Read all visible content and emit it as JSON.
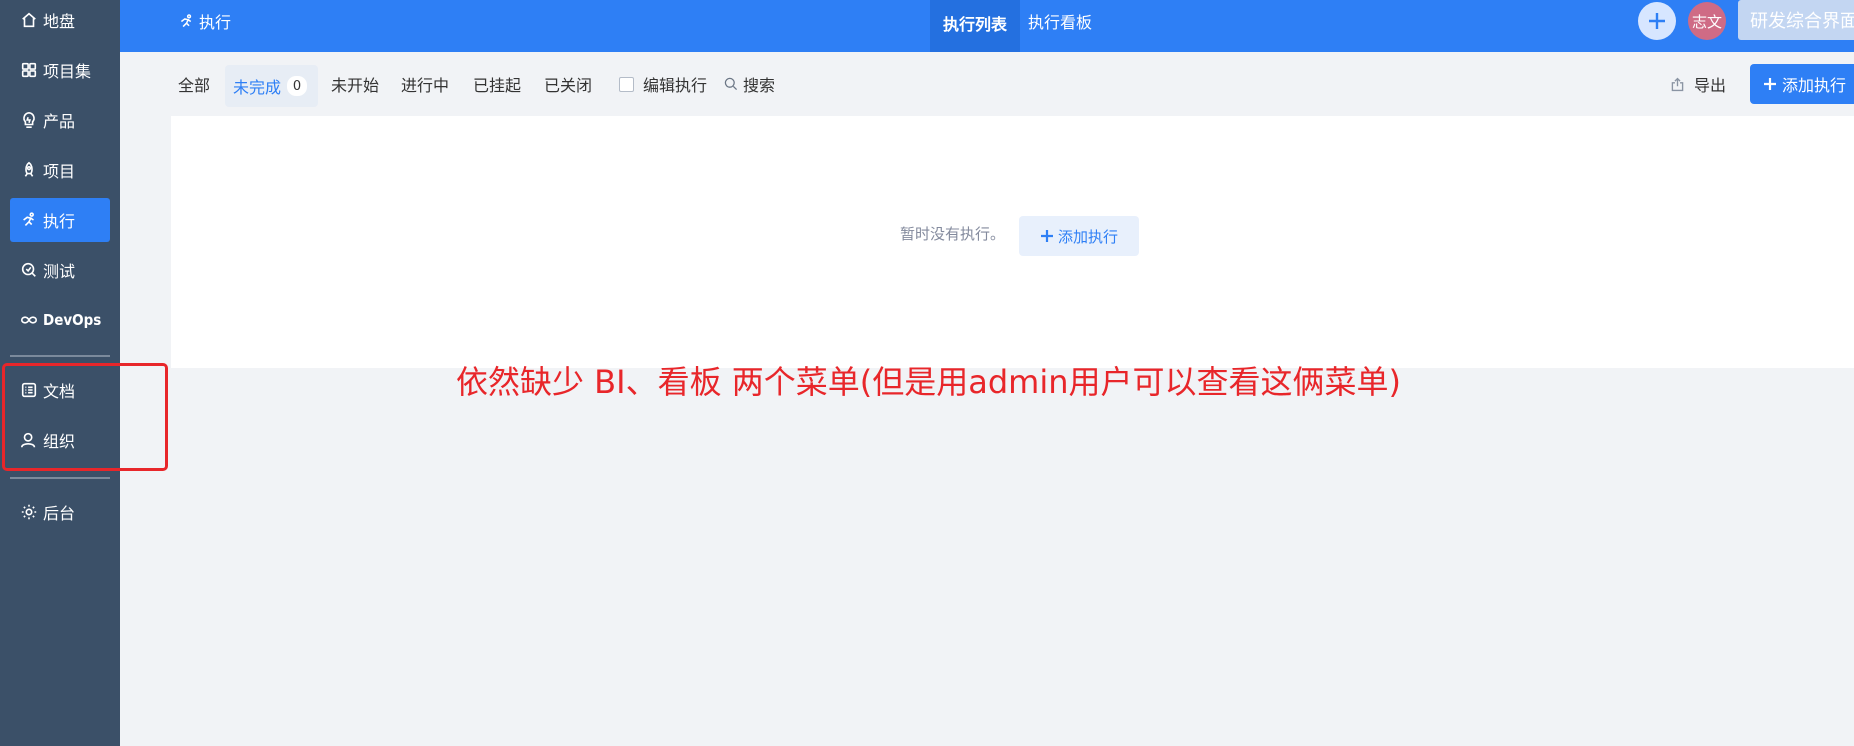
{
  "sidebar": {
    "items": [
      {
        "label": "地盘",
        "icon": "home-icon"
      },
      {
        "label": "项目集",
        "icon": "grid-icon"
      },
      {
        "label": "产品",
        "icon": "bulb-icon"
      },
      {
        "label": "项目",
        "icon": "rocket-icon"
      },
      {
        "label": "执行",
        "icon": "run-icon",
        "active": true
      },
      {
        "label": "测试",
        "icon": "test-icon"
      },
      {
        "label": "DevOps",
        "icon": "infinity-icon"
      },
      {
        "label": "文档",
        "icon": "doc-icon"
      },
      {
        "label": "组织",
        "icon": "user-icon"
      },
      {
        "label": "后台",
        "icon": "gear-icon"
      }
    ]
  },
  "header": {
    "breadcrumb": "执行",
    "tabs": [
      {
        "label": "执行列表",
        "active": true
      },
      {
        "label": "执行看板",
        "active": false
      }
    ],
    "avatar_text": "志文",
    "workspace": "研发综合界面"
  },
  "toolbar": {
    "filters": [
      {
        "label": "全部"
      },
      {
        "label": "未完成",
        "count": "0",
        "active": true
      },
      {
        "label": "未开始"
      },
      {
        "label": "进行中"
      },
      {
        "label": "已挂起"
      },
      {
        "label": "已关闭"
      }
    ],
    "edit_checkbox_label": "编辑执行",
    "search_label": "搜索",
    "export_label": "导出",
    "add_label": "添加执行"
  },
  "main": {
    "empty_text": "暂时没有执行。",
    "empty_button": "添加执行"
  },
  "annotation": {
    "text": "依然缺少 BI、看板  两个菜单(但是用admin用户可以查看这俩菜单)",
    "color": "#e8262a"
  },
  "colors": {
    "sidebar": "#3b5068",
    "primary": "#2e7ff5",
    "avatar": "#cf6b85"
  }
}
